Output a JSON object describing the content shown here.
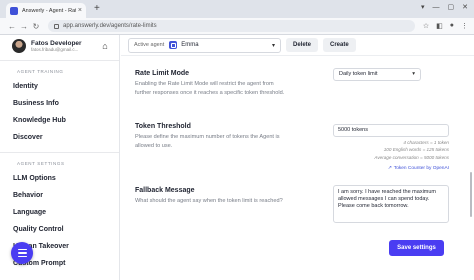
{
  "browser": {
    "tab_title": "Answerly - Agent - Rate Limit",
    "tab_close": "×",
    "new_tab": "+",
    "url": "app.answerly.dev/agents/rate-limits",
    "window_buttons": [
      "▾",
      "—",
      "▢",
      "✕"
    ]
  },
  "sidebar": {
    "profile_name": "Fatos Developer",
    "profile_email": "fatos.fribadu@gmail.c...",
    "section_training": "AGENT TRAINING",
    "training_items": [
      "Identity",
      "Business Info",
      "Knowledge Hub",
      "Discover"
    ],
    "section_settings": "AGENT SETTINGS",
    "settings_items": [
      "LLM Options",
      "Behavior",
      "Language",
      "Quality Control",
      "Human Takeover",
      "Custom Prompt"
    ]
  },
  "topbar": {
    "agent_label": "Active agent",
    "agent_name": "Emma",
    "delete_label": "Delete",
    "create_label": "Create"
  },
  "settings": {
    "rate_limit": {
      "title": "Rate Limit Mode",
      "description": "Enabling the Rate Limit Mode will restrict the agent from further responses once it reaches a specific token threshold.",
      "value": "Daily token limit"
    },
    "token_threshold": {
      "title": "Token Threshold",
      "description": "Please define the maximum number of tokens the Agent is allowed to use.",
      "value": "5000 tokens",
      "stats": [
        "4 characters = 1 token",
        "100 English words = 125 tokens",
        "Average conversation = 5000 tokens"
      ],
      "link": "Token Counter by OpenAI"
    },
    "fallback": {
      "title": "Fallback Message",
      "description": "What should the agent say when the token limit is reached?",
      "value": "I am sorry. I have reached the maximum allowed messages I can spend today. Please come back tomorrow."
    }
  },
  "save_label": "Save settings",
  "colors": {
    "accent": "#4a3df2",
    "link": "#3f51d8"
  }
}
